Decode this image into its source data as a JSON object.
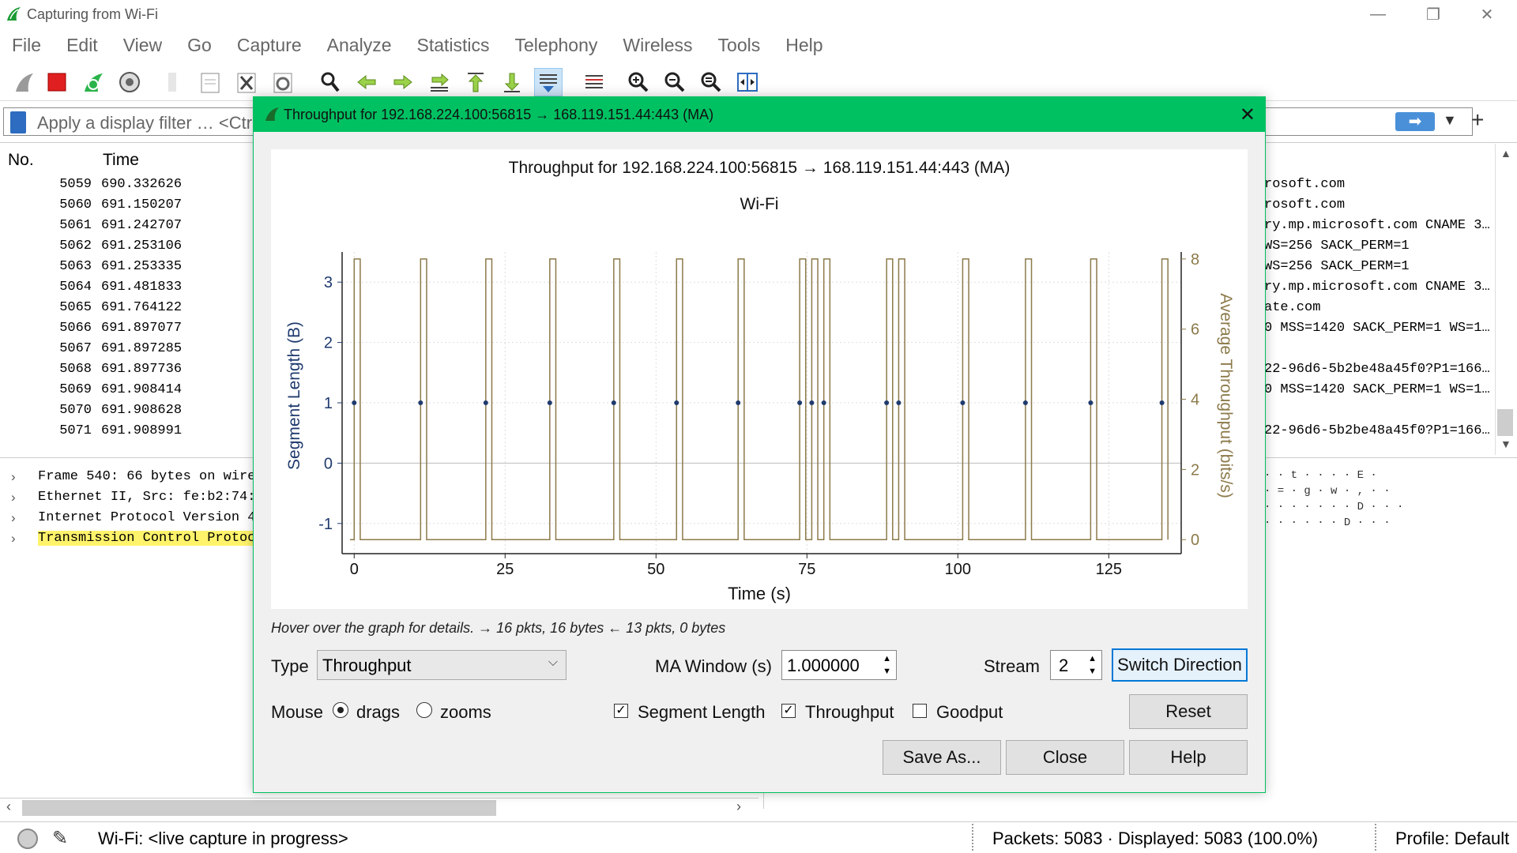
{
  "window": {
    "title": "Capturing from Wi-Fi"
  },
  "menu": [
    "File",
    "Edit",
    "View",
    "Go",
    "Capture",
    "Analyze",
    "Statistics",
    "Telephony",
    "Wireless",
    "Tools",
    "Help"
  ],
  "filter": {
    "placeholder": "Apply a display filter … <Ctr"
  },
  "packet_list": {
    "headers": {
      "no": "No.",
      "time": "Time"
    },
    "rows": [
      {
        "no": "5059",
        "time": "690.332626",
        "info": "rosoft.com"
      },
      {
        "no": "5060",
        "time": "691.150207",
        "info": "rosoft.com"
      },
      {
        "no": "5061",
        "time": "691.242707",
        "info": "ry.mp.microsoft.com CNAME 3…"
      },
      {
        "no": "5062",
        "time": "691.253106",
        "info": "WS=256 SACK_PERM=1"
      },
      {
        "no": "5063",
        "time": "691.253335",
        "info": "WS=256 SACK_PERM=1"
      },
      {
        "no": "5064",
        "time": "691.481833",
        "info": "ry.mp.microsoft.com CNAME 3…"
      },
      {
        "no": "5065",
        "time": "691.764122",
        "info": "ate.com"
      },
      {
        "no": "5066",
        "time": "691.897077",
        "info": "0 MSS=1420 SACK_PERM=1 WS=1…"
      },
      {
        "no": "5067",
        "time": "691.897285",
        "info": ""
      },
      {
        "no": "5068",
        "time": "691.897736",
        "info": "22-96d6-5b2be48a45f0?P1=166…"
      },
      {
        "no": "5069",
        "time": "691.908414",
        "info": "0 MSS=1420 SACK_PERM=1 WS=1…"
      },
      {
        "no": "5070",
        "time": "691.908628",
        "info": ""
      },
      {
        "no": "5071",
        "time": "691.908991",
        "info": "22-96d6-5b2be48a45f0?P1=166…"
      }
    ]
  },
  "details": [
    {
      "text": "Frame 540: 66 bytes on wire",
      "highlight": false
    },
    {
      "text": "Ethernet II, Src: fe:b2:74:6",
      "highlight": false
    },
    {
      "text": "Internet Protocol Version 4,",
      "highlight": false
    },
    {
      "text": "Transmission Control Protoco",
      "highlight": true
    }
  ],
  "bytes_ascii": [
    "· · t · · · · E ·",
    "· = · g · w · , · ·",
    "· · · · · · · D · · ·",
    "· · · · · · D · · ·"
  ],
  "status": {
    "capture": "Wi-Fi: <live capture in progress>",
    "packets": "Packets: 5083 · Displayed: 5083 (100.0%)",
    "profile": "Profile: Default"
  },
  "dialog": {
    "title": "Throughput for 192.168.224.100:56815 → 168.119.151.44:443 (MA)",
    "hint": "Hover over the graph for details. → 16 pkts, 16 bytes ← 13 pkts, 0 bytes",
    "type_label": "Type",
    "type_value": "Throughput",
    "ma_window_label": "MA Window (s)",
    "ma_window_value": "1.000000",
    "stream_label": "Stream",
    "stream_value": "2",
    "switch_direction": "Switch Direction",
    "mouse_label": "Mouse",
    "mouse_drags": "drags",
    "mouse_zooms": "zooms",
    "mouse_selected": "drags",
    "segment_length": {
      "label": "Segment Length",
      "checked": true
    },
    "throughput": {
      "label": "Throughput",
      "checked": true
    },
    "goodput": {
      "label": "Goodput",
      "checked": false
    },
    "reset": "Reset",
    "save_as": "Save As...",
    "close": "Close",
    "help": "Help"
  },
  "chart_data": {
    "type": "line",
    "title": "Throughput for 192.168.224.100:56815 → 168.119.151.44:443 (MA)",
    "subtitle": "Wi-Fi",
    "xlabel": "Time (s)",
    "ylabel": "Segment Length (B)",
    "y2label": "Average Throughput (bits/s)",
    "xlim": [
      -2,
      137
    ],
    "ylim": [
      -1.5,
      3.5
    ],
    "y2lim": [
      -0.4,
      8.2
    ],
    "xticks": [
      0,
      25,
      50,
      75,
      100,
      125
    ],
    "yticks": [
      -1,
      0,
      1,
      2,
      3
    ],
    "y2ticks": [
      0,
      2,
      4,
      6,
      8
    ],
    "grid": true,
    "colors": {
      "segment": "#1f3a6e",
      "throughput": "#8c7a4a"
    },
    "series": [
      {
        "name": "Segment Length",
        "axis": "left",
        "style": "dots",
        "x": [
          0,
          11,
          21.8,
          32.4,
          43,
          53.4,
          63.6,
          73.8,
          75.8,
          77.8,
          88.2,
          90.2,
          100.8,
          111.2,
          122,
          133.8
        ],
        "y": [
          1,
          1,
          1,
          1,
          1,
          1,
          1,
          1,
          1,
          1,
          1,
          1,
          1,
          1,
          1,
          1
        ]
      },
      {
        "name": "Throughput",
        "axis": "right",
        "style": "pulses",
        "pulse_width": 1.0,
        "high": 8,
        "low": 0,
        "x": [
          0,
          11,
          21.8,
          32.4,
          43,
          53.4,
          63.6,
          73.8,
          75.8,
          77.8,
          88.2,
          90.2,
          100.8,
          111.2,
          122,
          133.8
        ]
      }
    ]
  }
}
